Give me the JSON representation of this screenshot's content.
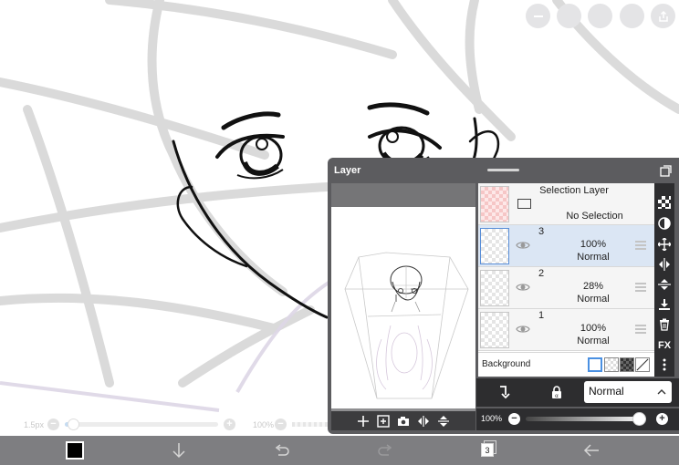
{
  "top_toolbar": {
    "buttons": [
      {
        "name": "minimize-icon"
      },
      {
        "name": "blank-round-1"
      },
      {
        "name": "blank-round-2"
      },
      {
        "name": "blank-round-3"
      },
      {
        "name": "export-icon"
      }
    ]
  },
  "brush_size": {
    "label": "1.5px",
    "decrease": "−",
    "increase": "+",
    "level": 0.02
  },
  "brush_opacity": {
    "label": "100%",
    "decrease": "−"
  },
  "layer_panel": {
    "title": "Layer",
    "selection_layer": {
      "title": "Selection Layer",
      "status": "No Selection"
    },
    "layers": [
      {
        "number": "3",
        "opacity": "100%",
        "blend": "Normal",
        "active": true
      },
      {
        "number": "2",
        "opacity": "28%",
        "blend": "Normal",
        "active": false
      },
      {
        "number": "1",
        "opacity": "100%",
        "blend": "Normal",
        "active": false
      }
    ],
    "background": {
      "label": "Background",
      "swatches": [
        "white",
        "transparent",
        "dark-checker",
        "none"
      ]
    },
    "side_tools": [
      "checker-icon",
      "contrast-icon",
      "move-icon",
      "flip-horizontal-icon",
      "flip-vertical-icon",
      "merge-down-icon",
      "trash-icon",
      "FX",
      "more-icon"
    ],
    "preview_tools": [
      "add-icon",
      "add-layer-icon",
      "camera-icon",
      "flip-horizontal-icon",
      "flip-vertical-icon"
    ],
    "blend_mode": {
      "value": "Normal"
    },
    "opacity": {
      "label": "100%",
      "decrease": "−",
      "increase": "+",
      "level": 1.0
    }
  },
  "bottom_bar": {
    "color_hex": "#000000",
    "layer_count": "3",
    "items": [
      "color-swatch",
      "down-arrow-icon",
      "undo-icon",
      "redo-icon",
      "layers-icon",
      "back-arrow-icon"
    ]
  },
  "colors": {
    "panel_bg": "#5c5c5f",
    "active_layer": "#dbe6f4",
    "bottom_bar": "#7e7e81"
  }
}
